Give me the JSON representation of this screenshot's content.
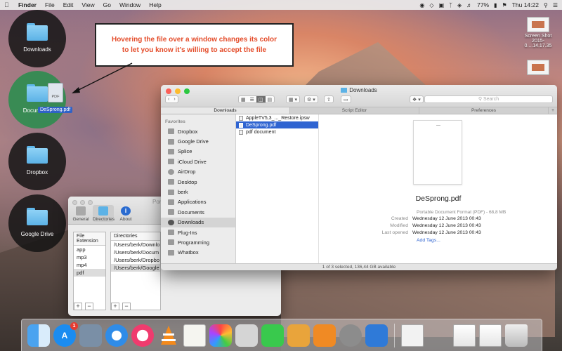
{
  "menubar": {
    "app_name": "Finder",
    "items": [
      "File",
      "Edit",
      "View",
      "Go",
      "Window",
      "Help"
    ],
    "battery": "77%",
    "clock": "Thu 14:22"
  },
  "drop_targets": [
    {
      "label": "Downloads"
    },
    {
      "label": "Documents"
    },
    {
      "label": "Dropbox"
    },
    {
      "label": "Google Drive"
    }
  ],
  "drag": {
    "file_icon_text": "PDF",
    "file_name": "DeSprong.pdf"
  },
  "annotation": {
    "line1": "Hovering the file over a window changes its color",
    "line2": "to let you know it’s willing to accept the file"
  },
  "desktop": {
    "screenshot_label_1": "Screen Shot",
    "screenshot_label_2": "2015-0....14.17.35"
  },
  "prefs": {
    "title": "Por",
    "tabs": [
      "General",
      "Directories",
      "About"
    ],
    "ext_header": "File Extension",
    "dir_header": "Directories",
    "extensions": [
      "app",
      "mp3",
      "mp4",
      "pdf"
    ],
    "directories": [
      "/Users/berk/Downlo",
      "/Users/berk/Docum",
      "/Users/berk/Dropbo",
      "/Users/berk/Google"
    ],
    "add": "+",
    "remove": "−"
  },
  "finder": {
    "title": "Downloads",
    "search_placeholder": "Search",
    "tabs": [
      "Downloads",
      "Script Editor",
      "Preferences"
    ],
    "tab_plus": "+",
    "sidebar_heading": "Favorites",
    "sidebar": [
      "Dropbox",
      "Google Drive",
      "Splice",
      "iCloud Drive",
      "AirDrop",
      "Desktop",
      "berk",
      "Applications",
      "Documents",
      "Downloads",
      "Plug-Ins",
      "Programming",
      "Whatbox"
    ],
    "files": [
      "AppleTV5,3_..._Restore.ipsw",
      "DeSprong.pdf",
      "pdf document"
    ],
    "preview": {
      "name": "DeSprong.pdf",
      "kind": "Portable Document Format (PDF) - 68,8 MB",
      "meta": [
        {
          "k": "Created",
          "v": "Wednesday 12 June 2013 00:43"
        },
        {
          "k": "Modified",
          "v": "Wednesday 12 June 2013 00:43"
        },
        {
          "k": "Last opened",
          "v": "Wednesday 12 June 2013 00:43"
        }
      ],
      "add_tags": "Add Tags..."
    },
    "status": "1 of 3 selected, 136,44 GB available"
  },
  "dock": {
    "app_store_badge": "1"
  },
  "colors": {
    "accent": "#2f64d1",
    "annotation_text": "#e44c2a",
    "active_target": "#308c50"
  }
}
